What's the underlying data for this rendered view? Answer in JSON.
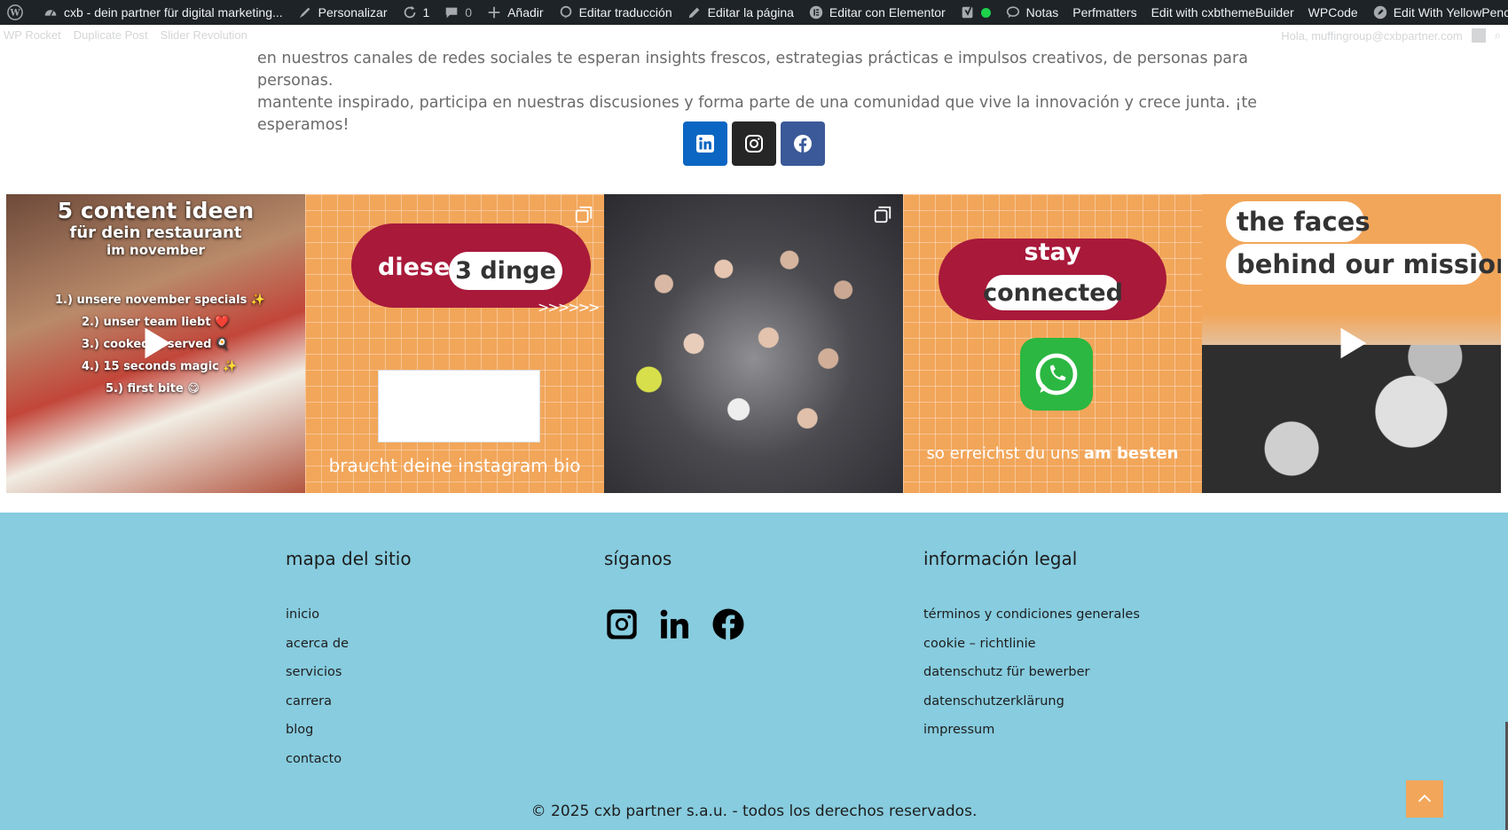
{
  "adminbar": {
    "site_title": "cxb - dein partner für digital marketing...",
    "customize": "Personalizar",
    "updates_count": "1",
    "comments_count": "0",
    "add_new": "Añadir",
    "edit_translation": "Editar traducción",
    "edit_page": "Editar la página",
    "edit_elementor": "Editar con Elementor",
    "notes": "Notas",
    "perfmatters": "Perfmatters",
    "edit_theme_builder": "Edit with cxbthemeBuilder",
    "wpcode": "WPCode",
    "edit_yellowpencil": "Edit With YellowPencil",
    "status_color": "#1ed14b"
  },
  "secondbar": {
    "items": [
      "WP Rocket",
      "Duplicate Post",
      "Slider Revolution"
    ],
    "greeting": "Hola, muffingroup@cxbpartner.com"
  },
  "intro": {
    "line1": "en nuestros canales de redes sociales te esperan insights frescos, estrategias prácticas e impulsos creativos, de personas para personas.",
    "line2": "mantente inspirado, participa en nuestras discusiones y forma parte de una comunidad que vive la innovación y crece junta. ¡te esperamos!"
  },
  "social_top": [
    {
      "icon": "linkedin-icon",
      "color": "#0a66c2"
    },
    {
      "icon": "instagram-icon",
      "color": "#262626"
    },
    {
      "icon": "facebook-icon",
      "color": "#3b5998"
    }
  ],
  "instagram": {
    "post1": {
      "title_a": "5 content ideen",
      "title_b": "für dein restaurant",
      "title_c": "im november",
      "items": [
        "1.) unsere november specials ✨",
        "2.) unser team liebt ❤️",
        "3.) cooked & served 🍳",
        "4.) 15 seconds magic ✨",
        "5.) first bite 😋"
      ]
    },
    "post2": {
      "pill_text": "diese",
      "highlight": "3 dinge",
      "arrows": ">>>>>>",
      "bottom": "braucht deine instagram bio"
    },
    "post4": {
      "stay": "stay",
      "connected": "connected",
      "bottom_plain": "so erreichst du uns",
      "bottom_bold": "am besten"
    },
    "post5": {
      "line1": "the faces",
      "line2": "behind our mission"
    }
  },
  "footer": {
    "sitemap_title": "mapa del sitio",
    "sitemap_links": [
      "inicio",
      "acerca de",
      "servicios",
      "carrera",
      "blog",
      "contacto"
    ],
    "follow_title": "síganos",
    "legal_title": "información legal",
    "legal_links": [
      "términos y condiciones generales",
      "cookie – richtlinie",
      "datenschutz für bewerber",
      "datenschutzerklärung",
      "impressum"
    ],
    "copyright": "© 2025 cxb partner s.a.u. - todos los derechos reservados.",
    "background_color": "#87ccdf",
    "accent_color": "#f2a65a"
  }
}
